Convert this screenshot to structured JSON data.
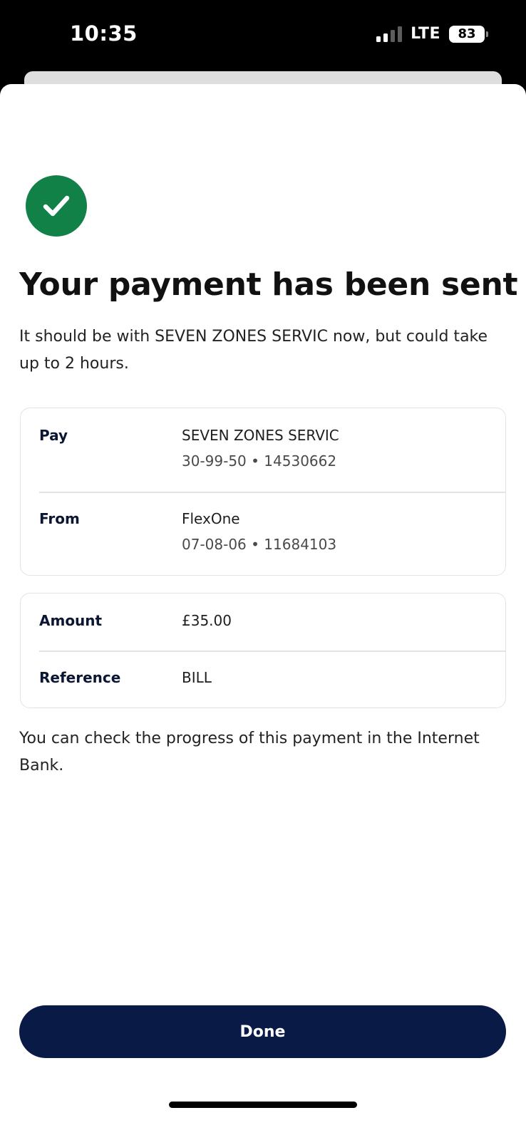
{
  "status_bar": {
    "time": "10:35",
    "network": "LTE",
    "battery": "83"
  },
  "success": {
    "icon": "check-icon",
    "color": "#128148"
  },
  "title": "Your payment has been sent",
  "subtitle": "It should be with SEVEN ZONES SERVIC now, but could take up to 2 hours.",
  "details": {
    "pay": {
      "label": "Pay",
      "name": "SEVEN ZONES SERVIC",
      "account": "30-99-50 • 14530662"
    },
    "from": {
      "label": "From",
      "name": "FlexOne",
      "account": "07-08-06 • 11684103"
    }
  },
  "summary": {
    "amount": {
      "label": "Amount",
      "value": "£35.00"
    },
    "reference": {
      "label": "Reference",
      "value": "BILL"
    }
  },
  "note": "You can check the progress of this payment in the Internet Bank.",
  "done_label": "Done",
  "colors": {
    "button_bg": "#0a1a47",
    "label_text": "#0b1633"
  }
}
